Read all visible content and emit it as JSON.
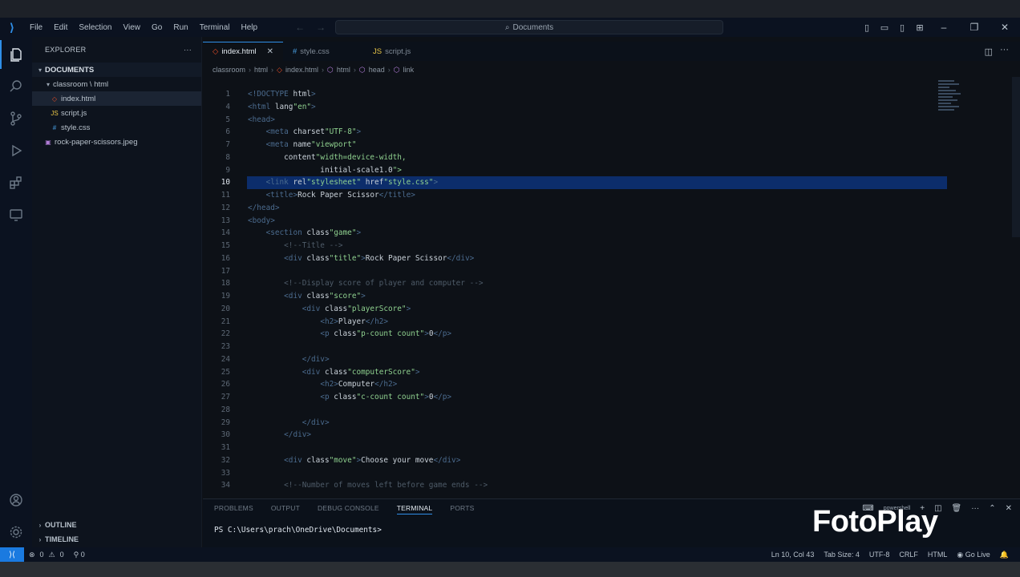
{
  "window": {
    "title": "Documents",
    "menu": [
      "File",
      "Edit",
      "Selection",
      "View",
      "Go",
      "Run",
      "Terminal",
      "Help"
    ]
  },
  "sidebar": {
    "header": "EXPLORER",
    "more": "···",
    "root": "DOCUMENTS",
    "folder": "classroom \\ html",
    "files": [
      "index.html",
      "script.js",
      "style.css"
    ],
    "image_file": "rock-paper-scissors.jpeg",
    "outline": "OUTLINE",
    "timeline": "TIMELINE"
  },
  "tabs": [
    {
      "label": "index.html",
      "icon": "html-icon"
    },
    {
      "label": "style.css",
      "icon": "css-icon"
    },
    {
      "label": "script.js",
      "icon": "js-icon"
    }
  ],
  "breadcrumb": [
    "classroom",
    "html",
    "index.html",
    "html",
    "head",
    "link"
  ],
  "editor": {
    "current_line": 10,
    "lines": [
      {
        "n": "1",
        "code": "<!DOCTYPE html>"
      },
      {
        "n": "4",
        "code": "<html lang=\"en\">"
      },
      {
        "n": "5",
        "code": "<head>"
      },
      {
        "n": "6",
        "code": "    <meta charset=\"UTF-8\">"
      },
      {
        "n": "7",
        "code": "    <meta name=\"viewport\""
      },
      {
        "n": "8",
        "code": "        content=\"width=device-width,"
      },
      {
        "n": "9",
        "code": "                initial-scale=1.0\">"
      },
      {
        "n": "10",
        "code": "    <link rel=\"stylesheet\" href=\"style.css\">"
      },
      {
        "n": "11",
        "code": "    <title>Rock Paper Scissor</title>"
      },
      {
        "n": "12",
        "code": "</head>"
      },
      {
        "n": "13",
        "code": "<body>"
      },
      {
        "n": "14",
        "code": "    <section class=\"game\">"
      },
      {
        "n": "15",
        "code": "        <!--Title -->"
      },
      {
        "n": "16",
        "code": "        <div class=\"title\">Rock Paper Scissor</div>"
      },
      {
        "n": "17",
        "code": ""
      },
      {
        "n": "18",
        "code": "        <!--Display score of player and computer -->"
      },
      {
        "n": "19",
        "code": "        <div class=\"score\">"
      },
      {
        "n": "20",
        "code": "            <div class=\"playerScore\">"
      },
      {
        "n": "21",
        "code": "                <h2>Player</h2>"
      },
      {
        "n": "22",
        "code": "                <p class=\"p-count count\">0</p>"
      },
      {
        "n": "23",
        "code": ""
      },
      {
        "n": "24",
        "code": "            </div>"
      },
      {
        "n": "25",
        "code": "            <div class=\"computerScore\">"
      },
      {
        "n": "26",
        "code": "                <h2>Computer</h2>"
      },
      {
        "n": "27",
        "code": "                <p class=\"c-count count\">0</p>"
      },
      {
        "n": "28",
        "code": ""
      },
      {
        "n": "29",
        "code": "            </div>"
      },
      {
        "n": "30",
        "code": "        </div>"
      },
      {
        "n": "31",
        "code": ""
      },
      {
        "n": "32",
        "code": "        <div class=\"move\">Choose your move</div>"
      },
      {
        "n": "33",
        "code": ""
      },
      {
        "n": "34",
        "code": "        <!--Number of moves left before game ends -->"
      }
    ]
  },
  "panel": {
    "tabs": [
      "PROBLEMS",
      "OUTPUT",
      "DEBUG CONSOLE",
      "TERMINAL",
      "PORTS"
    ],
    "active_tab": "TERMINAL",
    "terminal_name": "powershell",
    "prompt": "PS C:\\Users\\prach\\OneDrive\\Documents>"
  },
  "statusbar": {
    "errors": "0",
    "warnings": "0",
    "ports": "0",
    "position": "Ln 10, Col 43",
    "tab_size": "Tab Size: 4",
    "encoding": "UTF-8",
    "eol": "CRLF",
    "language": "HTML",
    "live": "Go Live"
  },
  "watermark": "FotoPlay",
  "colors": {
    "accent": "#2f8fe8",
    "line_highlight": "#0c2d6b",
    "string": "#8fd18f",
    "background": "#0d1117"
  }
}
